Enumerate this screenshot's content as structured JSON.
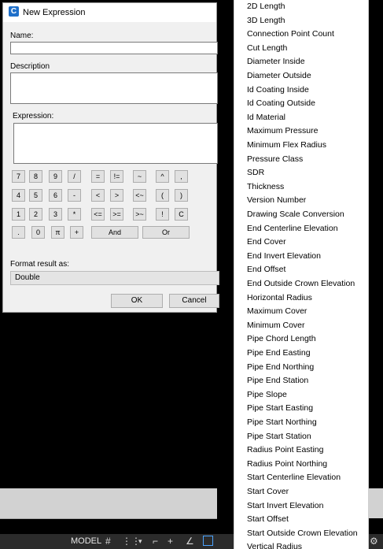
{
  "dialog": {
    "title": "New Expression",
    "icon": "C",
    "name_label": "Name:",
    "name_value": "",
    "description_label": "Description",
    "description_value": "",
    "expression_label": "Expression:",
    "expression_value": "",
    "keypad": [
      [
        "7",
        "8",
        "9",
        "/",
        "=",
        "!=",
        "~",
        "^",
        ","
      ],
      [
        "4",
        "5",
        "6",
        "-",
        "<",
        ">",
        "<~",
        "(",
        ")"
      ],
      [
        "1",
        "2",
        "3",
        "*",
        "<=",
        ">=",
        ">~",
        "!",
        "C"
      ],
      [
        ".",
        "0",
        "π",
        "+",
        "And",
        "Or"
      ]
    ],
    "format_label": "Format result as:",
    "format_value": "Double",
    "ok_label": "OK",
    "cancel_label": "Cancel"
  },
  "dropdown": {
    "items": [
      "2D Length",
      "3D Length",
      "Connection Point Count",
      "Cut Length",
      "Diameter Inside",
      "Diameter Outside",
      "Id Coating Inside",
      "Id Coating Outside",
      "Id Material",
      "Maximum Pressure",
      "Minimum Flex Radius",
      "Pressure Class",
      "SDR",
      "Thickness",
      "Version Number",
      "Drawing Scale Conversion",
      "End Centerline Elevation",
      "End Cover",
      "End Invert Elevation",
      "End Offset",
      "End Outside Crown Elevation",
      "Horizontal Radius",
      "Maximum Cover",
      "Minimum Cover",
      "Pipe Chord Length",
      "Pipe End Easting",
      "Pipe End Northing",
      "Pipe End Station",
      "Pipe Slope",
      "Pipe Start Easting",
      "Pipe Start Northing",
      "Pipe Start Station",
      "Radius Point Easting",
      "Radius Point Northing",
      "Start Centerline Elevation",
      "Start Cover",
      "Start Invert Elevation",
      "Start Offset",
      "Start Outside Crown Elevation",
      "Vertical Radius"
    ]
  },
  "statusbar": {
    "model_label": "MODEL"
  },
  "colors": {
    "background": "#000000",
    "dialog_bg": "#f0f0f0",
    "accent": "#1e6fc9"
  }
}
